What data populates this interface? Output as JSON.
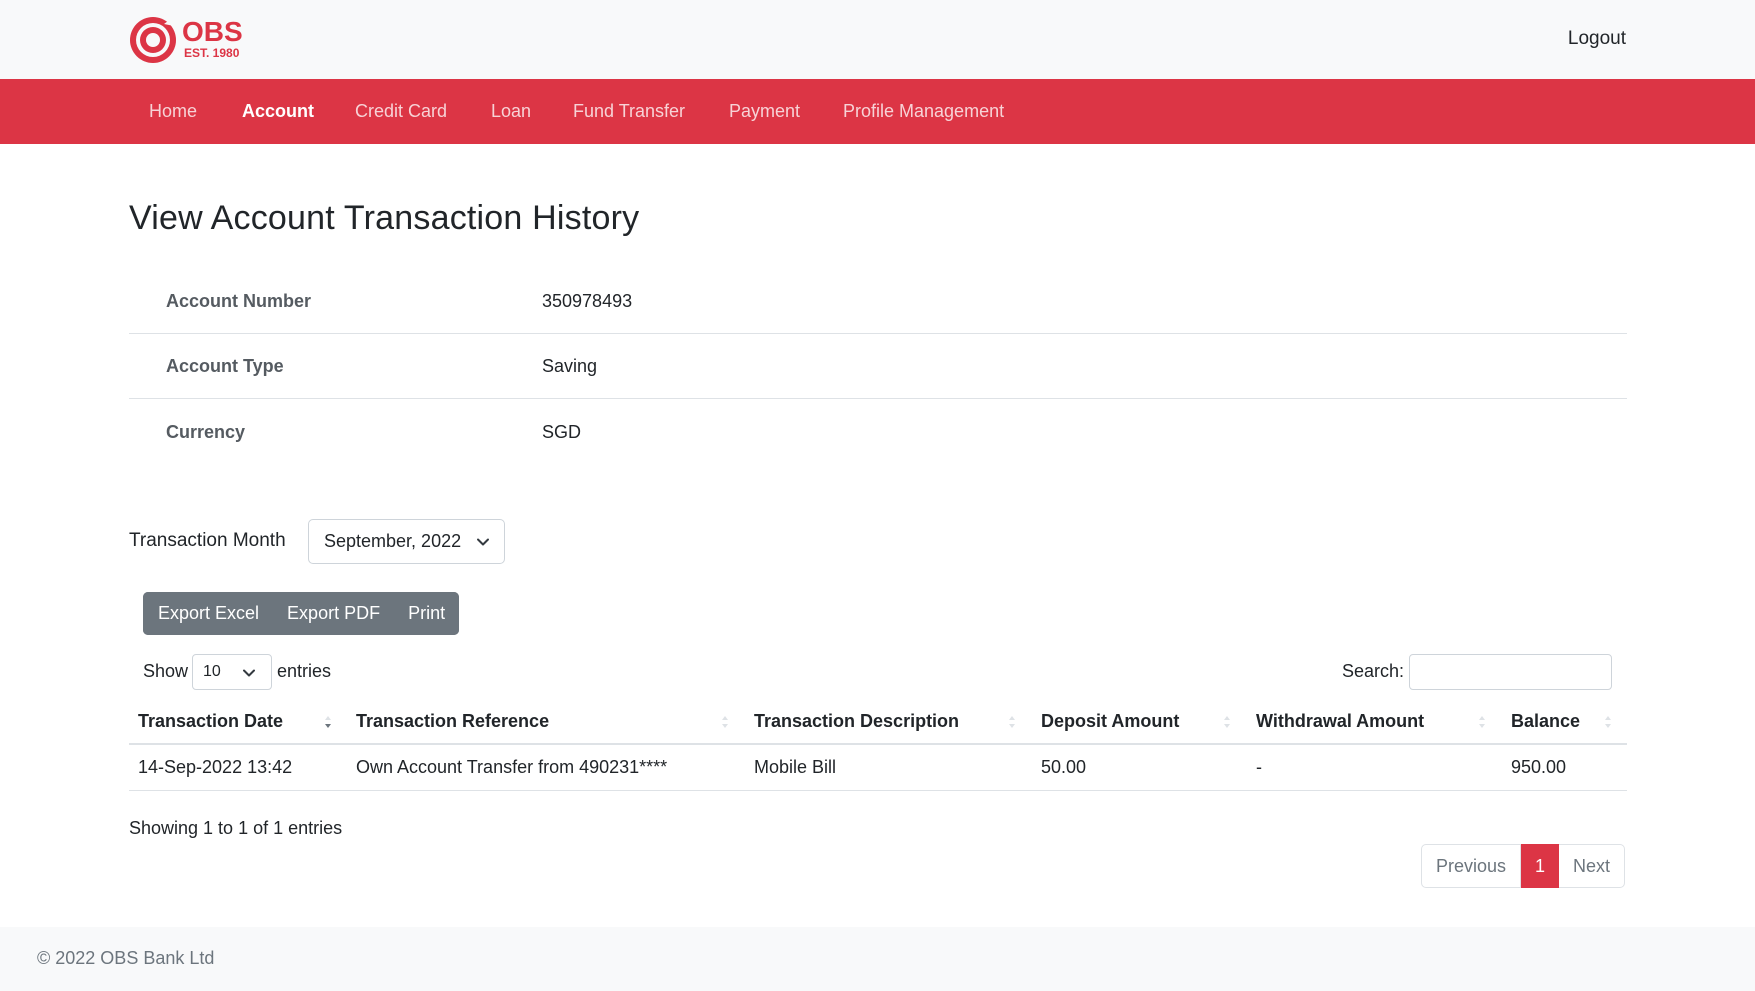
{
  "brand": {
    "name": "OBS",
    "tagline": "EST. 1980",
    "color": "#dc3545"
  },
  "header": {
    "logout_label": "Logout"
  },
  "nav": {
    "items": [
      {
        "label": "Home",
        "active": false
      },
      {
        "label": "Account",
        "active": true
      },
      {
        "label": "Credit Card",
        "active": false
      },
      {
        "label": "Loan",
        "active": false
      },
      {
        "label": "Fund Transfer",
        "active": false
      },
      {
        "label": "Payment",
        "active": false
      },
      {
        "label": "Profile Management",
        "active": false
      }
    ]
  },
  "main": {
    "title": "View Account Transaction History",
    "account_info": [
      {
        "label": "Account Number",
        "value": "350978493"
      },
      {
        "label": "Account Type",
        "value": "Saving"
      },
      {
        "label": "Currency",
        "value": "SGD"
      }
    ],
    "month_filter": {
      "label": "Transaction Month",
      "selected": "September, 2022"
    },
    "export_buttons": [
      "Export Excel",
      "Export PDF",
      "Print"
    ],
    "table_controls": {
      "show_label": "Show",
      "page_length": "10",
      "entries_label": "entries",
      "search_label": "Search:",
      "search_value": ""
    },
    "table": {
      "columns": [
        "Transaction Date",
        "Transaction Reference",
        "Transaction Description",
        "Deposit Amount",
        "Withdrawal Amount",
        "Balance"
      ],
      "rows": [
        [
          "14-Sep-2022 13:42",
          "Own Account Transfer from 490231****",
          "Mobile Bill",
          "50.00",
          "-",
          "950.00"
        ]
      ]
    },
    "table_info": "Showing 1 to 1 of 1 entries",
    "pagination": {
      "previous": "Previous",
      "current": "1",
      "next": "Next"
    }
  },
  "footer": {
    "text": "© 2022 OBS Bank Ltd"
  },
  "icons": {
    "logo": "target-ring-icon",
    "select_arrow": "chevron-down-icon",
    "sort": "sort-arrows-icon"
  }
}
